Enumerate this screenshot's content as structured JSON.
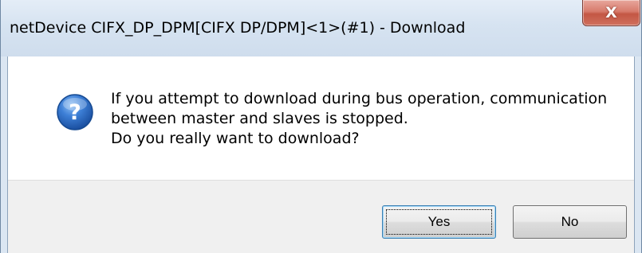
{
  "window": {
    "title": "netDevice CIFX_DP_DPM[CIFX DP/DPM]<1>(#1) - Download",
    "close_glyph": "X"
  },
  "message": {
    "icon": "question-icon",
    "lines": [
      "If you attempt to download during bus operation, communication",
      "between master and slaves is stopped.",
      "Do you really want to download?"
    ]
  },
  "buttons": {
    "yes_label": "Yes",
    "no_label": "No"
  },
  "colors": {
    "icon_blue": "#1f5fb5",
    "close_red": "#c35744",
    "titlebar": "#d6e3f1"
  }
}
